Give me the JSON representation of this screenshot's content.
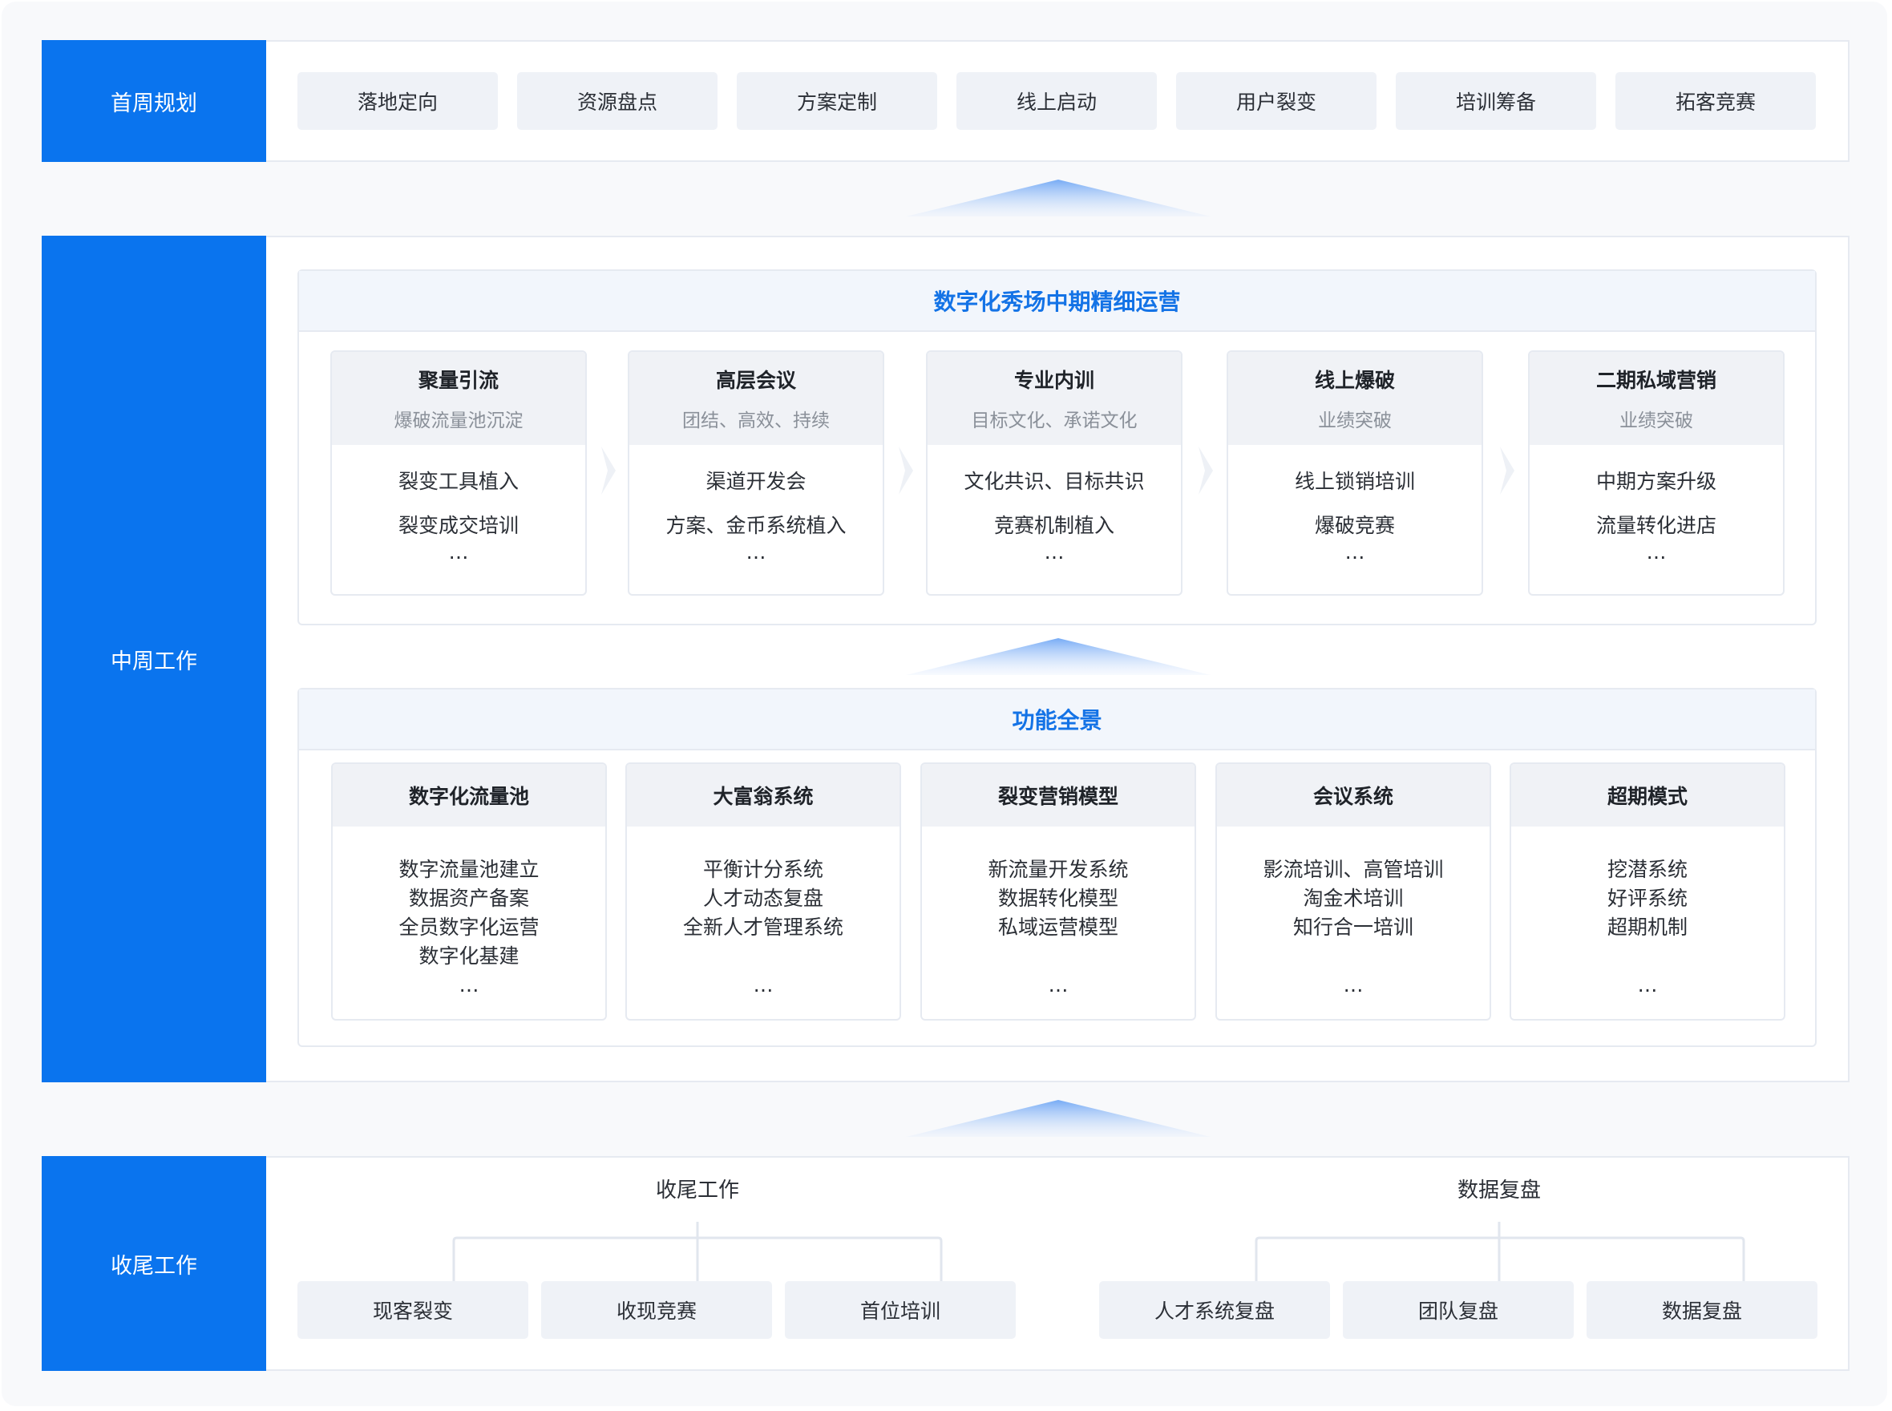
{
  "rows": {
    "first": {
      "label": "首周规划",
      "items": [
        "落地定向",
        "资源盘点",
        "方案定制",
        "线上启动",
        "用户裂变",
        "培训筹备",
        "拓客竞赛"
      ]
    },
    "middle": {
      "label": "中周工作",
      "ops": {
        "title": "数字化秀场中期精细运营",
        "cards": [
          {
            "title": "聚量引流",
            "subtitle": "爆破流量池沉淀",
            "items": [
              "裂变工具植入",
              "裂变成交培训",
              "…"
            ]
          },
          {
            "title": "高层会议",
            "subtitle": "团结、高效、持续",
            "items": [
              "渠道开发会",
              "方案、金币系统植入",
              "…"
            ]
          },
          {
            "title": "专业内训",
            "subtitle": "目标文化、承诺文化",
            "items": [
              "文化共识、目标共识",
              "竞赛机制植入",
              "…"
            ]
          },
          {
            "title": "线上爆破",
            "subtitle": "业绩突破",
            "items": [
              "线上锁销培训",
              "爆破竞赛",
              "…"
            ]
          },
          {
            "title": "二期私域营销",
            "subtitle": "业绩突破",
            "items": [
              "中期方案升级",
              "流量转化进店",
              "…"
            ]
          }
        ]
      },
      "features": {
        "title": "功能全景",
        "cards": [
          {
            "title": "数字化流量池",
            "items": [
              "数字流量池建立",
              "数据资产备案",
              "全员数字化运营",
              "数字化基建",
              "…"
            ]
          },
          {
            "title": "大富翁系统",
            "items": [
              "平衡计分系统",
              "人才动态复盘",
              "全新人才管理系统",
              "",
              "…"
            ]
          },
          {
            "title": "裂变营销模型",
            "items": [
              "新流量开发系统",
              "数据转化模型",
              "私域运营模型",
              "",
              "…"
            ]
          },
          {
            "title": "会议系统",
            "items": [
              "影流培训、高管培训",
              "淘金术培训",
              "知行合一培训",
              "",
              "…"
            ]
          },
          {
            "title": "超期模式",
            "items": [
              "挖潜系统",
              "好评系统",
              "超期机制",
              "",
              "…"
            ]
          }
        ]
      }
    },
    "last": {
      "label": "收尾工作",
      "groups": [
        {
          "title": "收尾工作",
          "items": [
            "现客裂变",
            "收现竞赛",
            "首位培训"
          ]
        },
        {
          "title": "数据复盘",
          "items": [
            "人才系统复盘",
            "团队复盘",
            "数据复盘"
          ]
        }
      ]
    }
  },
  "colors": {
    "accent": "#0a74ee",
    "header_text": "#1473e6",
    "pill_bg": "#eff2f7"
  }
}
